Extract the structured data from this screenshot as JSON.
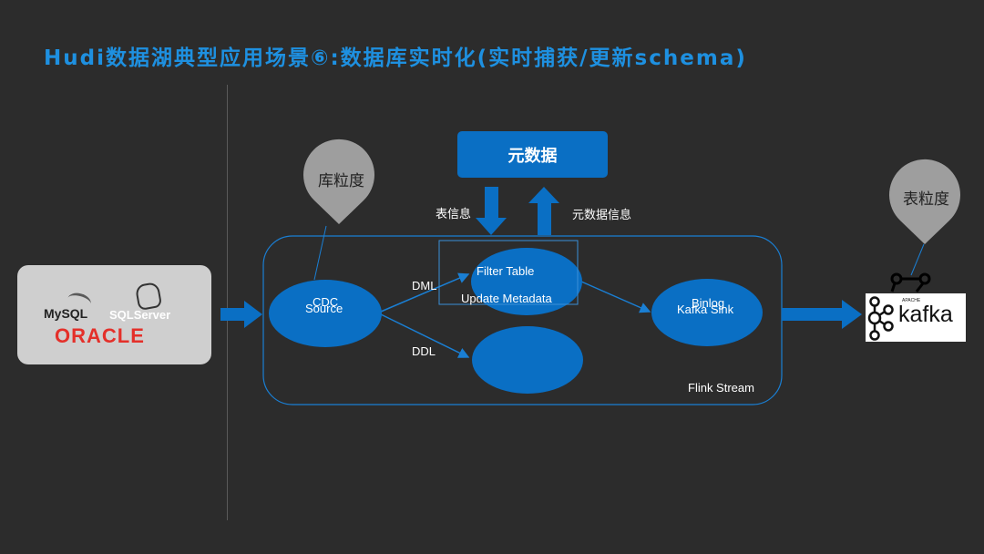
{
  "title": "Hudi数据湖典型应用场景⑥:数据库实时化(实时捕获/更新schema)",
  "metadata_box": "元数据",
  "arrow_labels": {
    "table_info": "表信息",
    "metadata_info": "元数据信息"
  },
  "pins": {
    "db_granularity": "库粒度",
    "table_granularity": "表粒度"
  },
  "databases": {
    "mysql": "MySQL",
    "sqlserver": "SQLServer",
    "oracle": "ORACLE"
  },
  "nodes": {
    "cdc_source_line1": "CDC",
    "cdc_source_line2": "Source",
    "filter_table": "Filter  Table",
    "update_metadata": "Update  Metadata",
    "binlog_line1": "Binlog",
    "binlog_line2": "Kafka Sink"
  },
  "edge_labels": {
    "dml": "DML",
    "ddl": "DDL"
  },
  "flink_stream": "Flink Stream",
  "kafka": {
    "apache": "APACHE",
    "name": "kafka"
  },
  "colors": {
    "title": "#1e90e0",
    "accent_blue": "#0a6fc4",
    "background": "#2c2c2c",
    "pin_grey": "#9e9e9e"
  }
}
